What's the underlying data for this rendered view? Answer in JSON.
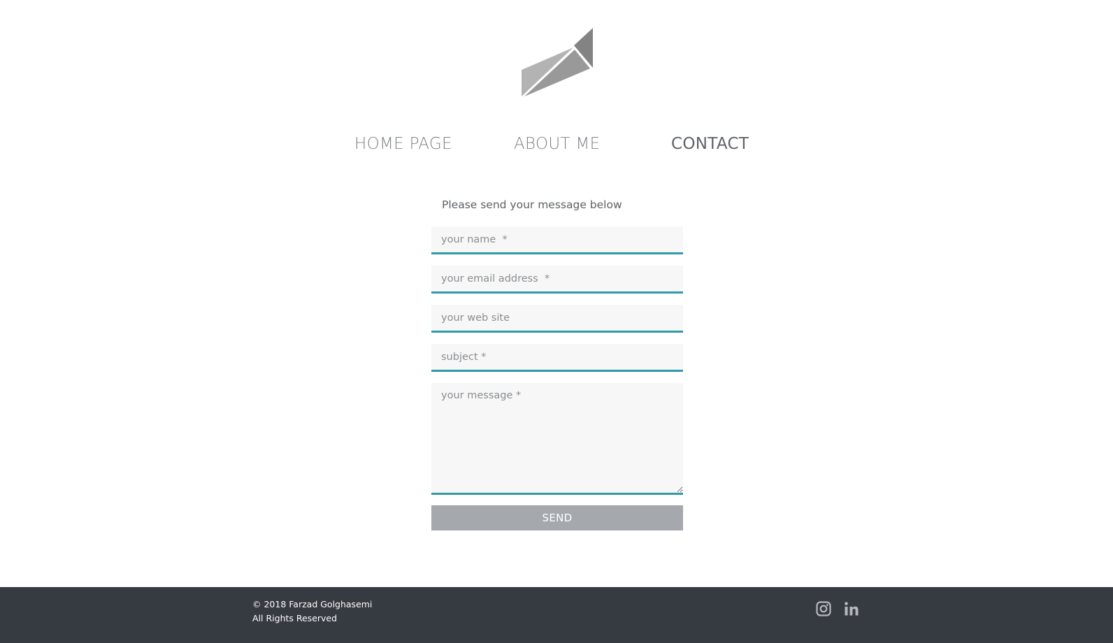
{
  "nav": {
    "items": [
      {
        "label": "HOME PAGE"
      },
      {
        "label": "ABOUT ME"
      },
      {
        "label": "CONTACT"
      }
    ],
    "active": "CONTACT"
  },
  "form": {
    "intro": "Please send your message below",
    "name_placeholder": "your name  *",
    "email_placeholder": "your email address  *",
    "website_placeholder": "your web site",
    "subject_placeholder": "subject *",
    "message_placeholder": "your message *",
    "send_label": "SEND"
  },
  "footer": {
    "copyright": "© 2018 Farzad Golghasemi",
    "rights": "All Rights Reserved",
    "social": [
      {
        "icon": "instagram-icon"
      },
      {
        "icon": "linkedin-icon"
      }
    ]
  },
  "colors": {
    "accent": "#2f9aa8",
    "footer_bg": "#363a41",
    "button_bg": "#a5a9ad",
    "field_bg": "#f7f7f7"
  }
}
